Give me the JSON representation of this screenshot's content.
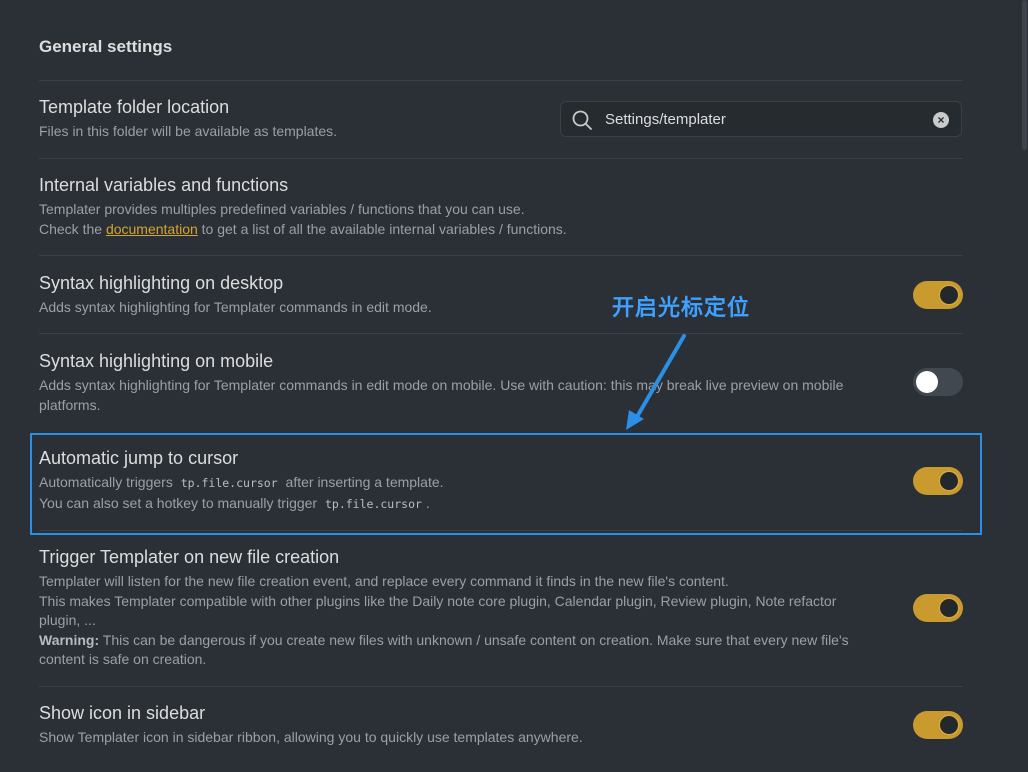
{
  "heading": "General settings",
  "settings": [
    {
      "name": "Template folder location",
      "desc": "Files in this folder will be available as templates."
    },
    {
      "name": "Internal variables and functions",
      "desc_line1": "Templater provides multiples predefined variables / functions that you can use.",
      "desc_line2_pre": "Check the",
      "desc_link": "documentation",
      "desc_line2_post": "to get a list of all the available internal variables / functions."
    },
    {
      "name": "Syntax highlighting on desktop",
      "desc": "Adds syntax highlighting for Templater commands in edit mode.",
      "enabled": true
    },
    {
      "name": "Syntax highlighting on mobile",
      "desc": "Adds syntax highlighting for Templater commands in edit mode on mobile. Use with caution: this may break live preview on mobile platforms.",
      "enabled": false
    },
    {
      "name": "Automatic jump to cursor",
      "desc_line1_pre": "Automatically triggers",
      "desc_code1": "tp.file.cursor",
      "desc_line1_post": "after inserting a template.",
      "desc_line2_pre": "You can also set a hotkey to manually trigger",
      "desc_code2": "tp.file.cursor",
      "desc_line2_post": ".",
      "enabled": true
    },
    {
      "name": "Trigger Templater on new file creation",
      "desc_line1": "Templater will listen for the new file creation event, and replace every command it finds in the new file's content.",
      "desc_line2": "This makes Templater compatible with other plugins like the Daily note core plugin, Calendar plugin, Review plugin, Note refactor plugin, ...",
      "warning_label": "Warning:",
      "warning_text": "This can be dangerous if you create new files with unknown / unsafe content on creation. Make sure that every new file's content is safe on creation.",
      "enabled": true
    },
    {
      "name": "Show icon in sidebar",
      "desc": "Show Templater icon in sidebar ribbon, allowing you to quickly use templates anywhere.",
      "enabled": true
    }
  ],
  "search": {
    "value": "Settings/templater",
    "icon": "search-icon",
    "clear_icon": "close-circle-icon",
    "clear_glyph": "×"
  },
  "annotation": {
    "text": "开启光标定位",
    "color": "#3ea0ff"
  },
  "colors": {
    "background": "#2b3036",
    "accent": "#c99a2e",
    "link": "#d6a530",
    "highlight": "#2b8fe6"
  }
}
